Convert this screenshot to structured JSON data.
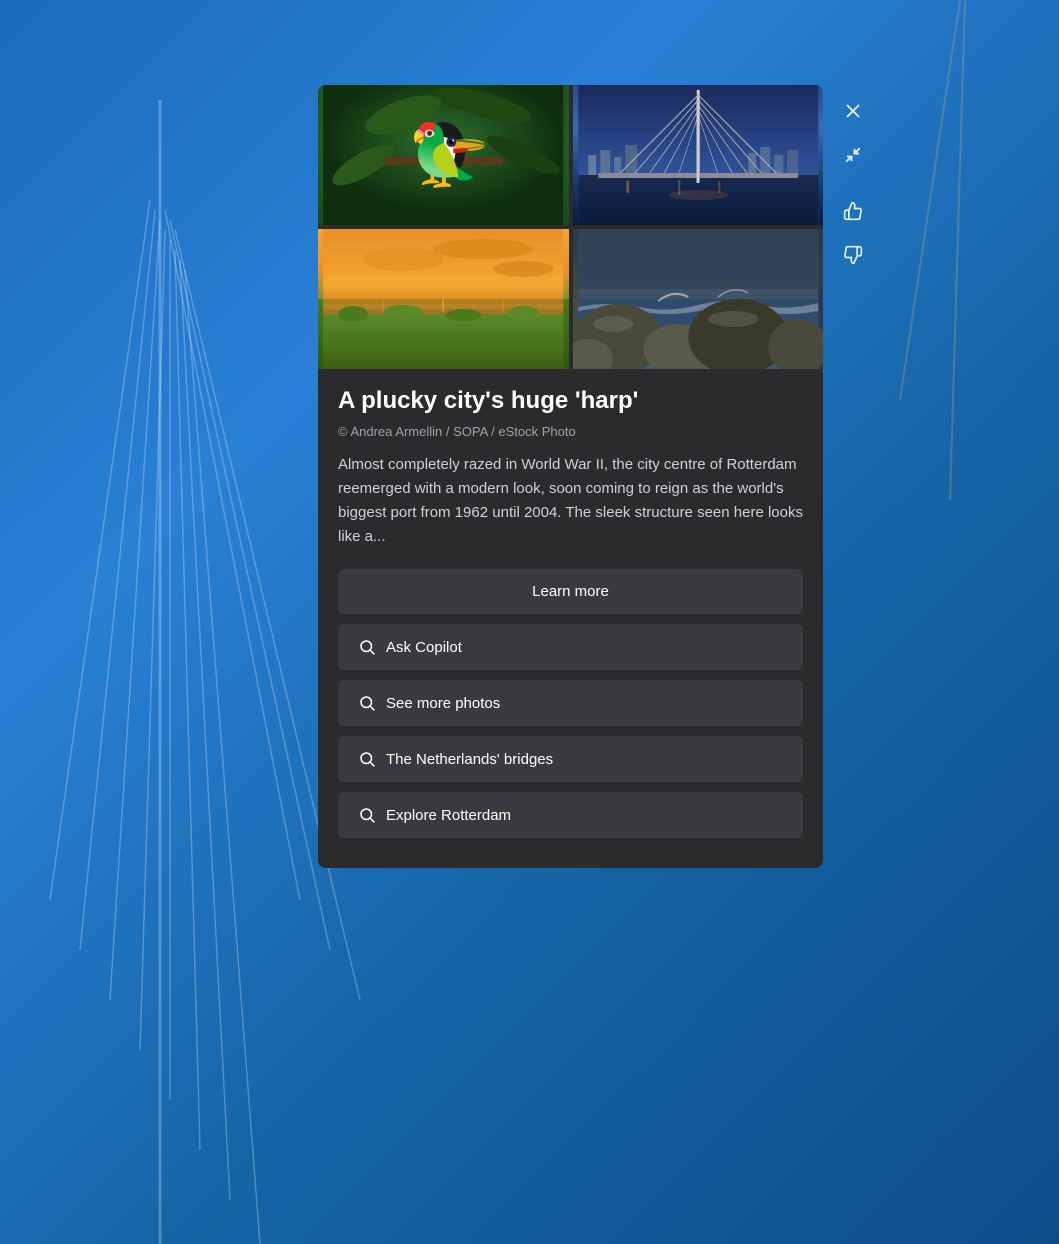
{
  "background": {
    "color": "#1a6bbf"
  },
  "panel": {
    "title": "A plucky city's huge 'harp'",
    "credit": "© Andrea Armellin / SOPA / eStock Photo",
    "description": "Almost completely razed in World War II, the city centre of Rotterdam reemerged with a modern look, soon coming to reign as the world's biggest port from 1962 until 2004. The sleek structure seen here looks like a...",
    "photos": [
      {
        "id": "toucan",
        "alt": "Toucan on branch",
        "selected": false
      },
      {
        "id": "bridge",
        "alt": "Rotterdam Erasmus Bridge at dusk",
        "selected": true
      },
      {
        "id": "wetlands",
        "alt": "Wetlands at sunset",
        "selected": false
      },
      {
        "id": "rocky-coast",
        "alt": "Rocky coast with waves",
        "selected": false
      }
    ]
  },
  "buttons": {
    "learn_more": "Learn more",
    "ask_copilot": "Ask Copilot",
    "see_more_photos": "See more photos",
    "netherlands_bridges": "The Netherlands' bridges",
    "explore_rotterdam": "Explore Rotterdam"
  },
  "sidebar": {
    "close_label": "Close",
    "collapse_label": "Collapse",
    "thumbs_up_label": "Like",
    "thumbs_down_label": "Dislike"
  },
  "icons": {
    "close": "✕",
    "collapse": "⤢",
    "thumbs_up": "👍",
    "thumbs_down": "👎",
    "search": "search"
  }
}
